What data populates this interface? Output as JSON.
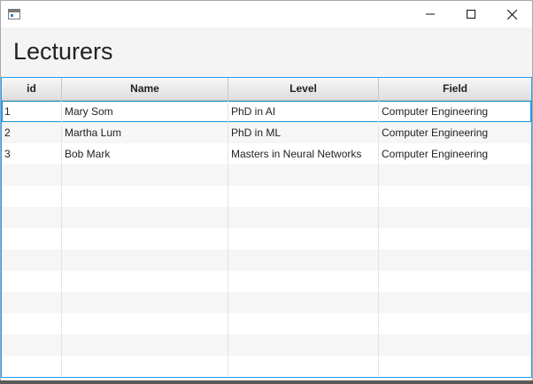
{
  "window": {
    "title": "",
    "controls": {
      "minimize": "minimize-icon",
      "maximize": "maximize-icon",
      "close": "close-icon"
    }
  },
  "header": {
    "title": "Lecturers"
  },
  "table": {
    "columns": [
      "id",
      "Name",
      "Level",
      "Field"
    ],
    "rows": [
      [
        "1",
        "Mary Som",
        "PhD in AI",
        "Computer Engineering"
      ],
      [
        "2",
        "Martha Lum",
        "PhD in ML",
        "Computer Engineering"
      ],
      [
        "3",
        "Bob Mark",
        "Masters in Neural Networks",
        "Computer Engineering"
      ]
    ],
    "selected_row": 0
  },
  "colors": {
    "accent": "#1ea0ff",
    "selection_outline": "#1f93d1"
  }
}
